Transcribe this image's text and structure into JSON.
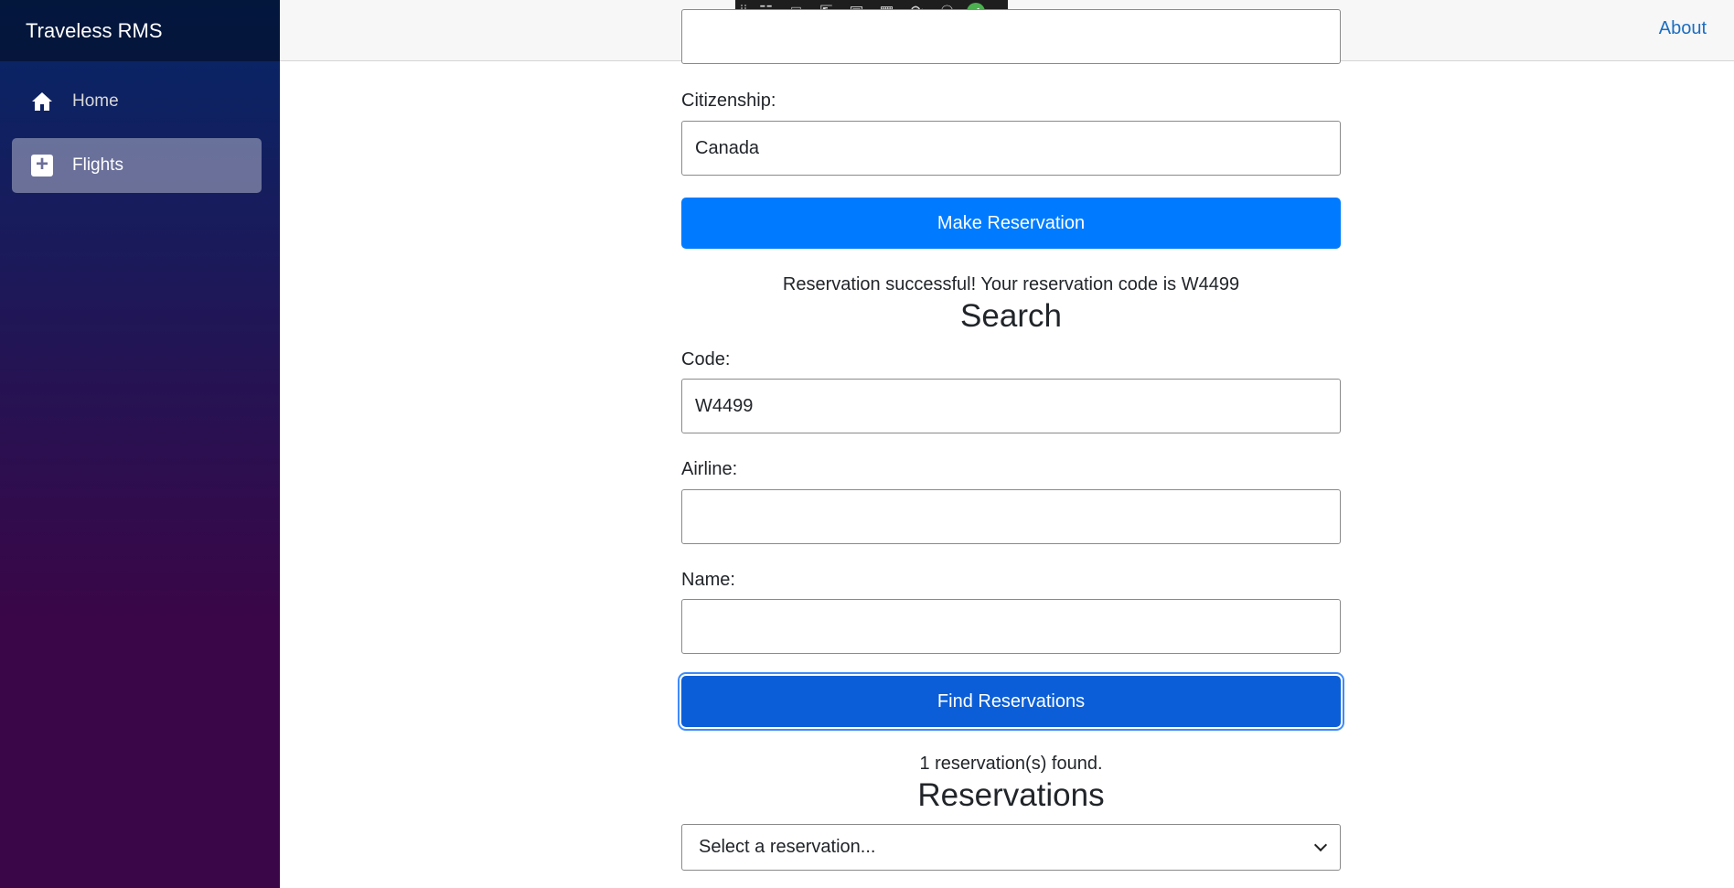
{
  "app": {
    "brand": "Traveless RMS"
  },
  "sidebar": {
    "items": [
      {
        "label": "Home",
        "icon": "home-icon",
        "active": false
      },
      {
        "label": "Flights",
        "icon": "plus-square-icon",
        "active": true
      }
    ]
  },
  "top_row": {
    "about": "About"
  },
  "devtools": {
    "icons": [
      "live-visual-tree-icon",
      "camera-icon",
      "select-element-icon",
      "display-layout-icon",
      "track-focus-icon",
      "hot-reload-icon",
      "accessibility-icon",
      "check-icon",
      "collapse-icon"
    ]
  },
  "form": {
    "citizenship_label": "Citizenship:",
    "citizenship_value": "Canada",
    "make_reservation": "Make Reservation",
    "success_message": "Reservation successful! Your reservation code is W4499"
  },
  "search": {
    "heading": "Search",
    "code_label": "Code:",
    "code_value": "W4499",
    "airline_label": "Airline:",
    "airline_value": "",
    "name_label": "Name:",
    "name_value": "",
    "find_button": "Find Reservations",
    "result_message": "1 reservation(s) found."
  },
  "reservations": {
    "heading": "Reservations",
    "select_value": "Select a reservation..."
  },
  "colors": {
    "primary": "#007bff",
    "primary_focused": "#0b5ed7",
    "link": "#1b6ec2",
    "sidebar_top": "#052767",
    "sidebar_bottom": "#3a0647"
  }
}
